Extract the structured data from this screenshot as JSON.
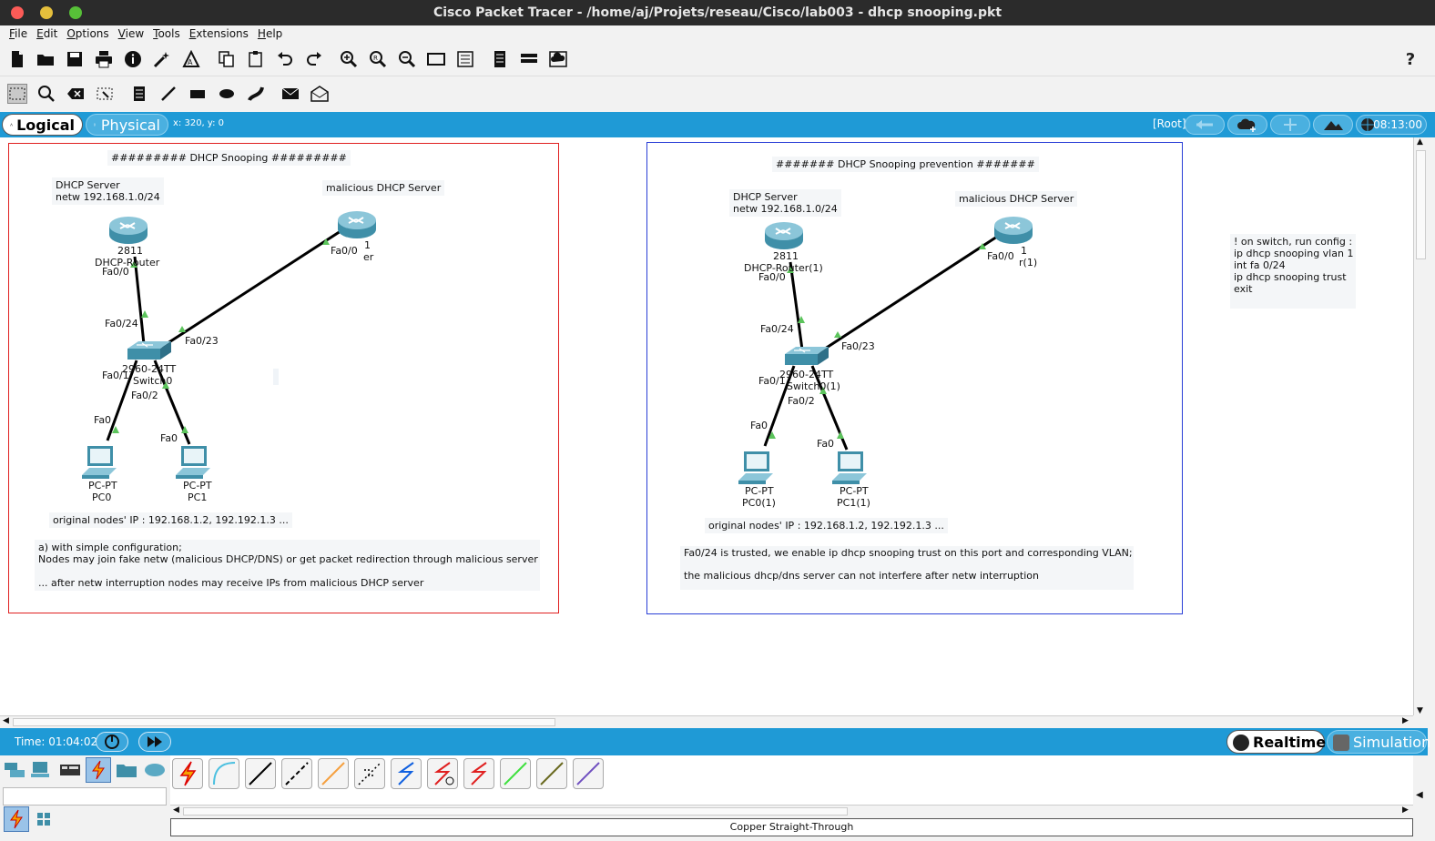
{
  "window": {
    "title": "Cisco Packet Tracer - /home/aj/Projets/reseau/Cisco/lab003 - dhcp snooping.pkt"
  },
  "menu": [
    "File",
    "Edit",
    "Options",
    "View",
    "Tools",
    "Extensions",
    "Help"
  ],
  "toolbar": {
    "main_icons": [
      "new-file-icon",
      "open-folder-icon",
      "save-icon",
      "print-icon",
      "info-icon",
      "activity-wizard-icon",
      "custom-device-icon",
      "copy-icon",
      "paste-icon",
      "undo-icon",
      "redo-icon",
      "zoom-in-icon",
      "zoom-reset-icon",
      "zoom-out-icon",
      "drawing-palette-icon",
      "custom-devices-dialog-icon",
      "pdu-list-icon",
      "network-info-icon",
      "cloud-icon"
    ],
    "help_label": "?"
  },
  "viewbar": {
    "logical_label": "Logical",
    "physical_label": "Physical",
    "coords": "x: 320, y: 0",
    "root_label": "[Root]",
    "clock": "08:13:00"
  },
  "left_topology": {
    "title": "######### DHCP Snooping #########",
    "dhcp_server_note": "DHCP Server\nnetw 192.168.1.0/24",
    "malicious_note": "malicious DHCP Server",
    "router_model": "2811",
    "router_name": "DHCP-Router",
    "malicious_model_tail": "1",
    "malicious_name_tail": "er",
    "switch_model": "2960-24TT",
    "switch_name": "Switch0",
    "pc0_model": "PC-PT",
    "pc0_name": "PC0",
    "pc1_model": "PC-PT",
    "pc1_name": "PC1",
    "ports": {
      "r_fa00": "Fa0/0",
      "m_fa00": "Fa0/0",
      "sw_fa024": "Fa0/24",
      "sw_fa023": "Fa0/23",
      "sw_fa01": "Fa0/1",
      "sw_fa02": "Fa0/2",
      "pc0_fa0": "Fa0",
      "pc1_fa0": "Fa0"
    },
    "ip_note": "original nodes' IP : 192.168.1.2, 192.192.1.3 ...",
    "desc_note": "a) with simple configuration;\nNodes may join fake netw (malicious DHCP/DNS) or get packet redirection through malicious server\n\n... after netw interruption nodes may receive IPs from malicious DHCP server"
  },
  "right_topology": {
    "title": "####### DHCP Snooping prevention #######",
    "dhcp_server_note": "DHCP Server\nnetw 192.168.1.0/24",
    "malicious_note": "malicious DHCP Server",
    "router_model": "2811",
    "router_name": "DHCP-Router(1)",
    "malicious_model_tail": "1",
    "malicious_name_tail": "r(1)",
    "switch_model": "2960-24TT",
    "switch_name": "Switch0(1)",
    "pc0_model": "PC-PT",
    "pc0_name": "PC0(1)",
    "pc1_model": "PC-PT",
    "pc1_name": "PC1(1)",
    "ports": {
      "r_fa00": "Fa0/0",
      "m_fa00": "Fa0/0",
      "sw_fa024": "Fa0/24",
      "sw_fa023": "Fa0/23",
      "sw_fa01": "Fa0/1",
      "sw_fa02": "Fa0/2",
      "pc0_fa0": "Fa0",
      "pc1_fa0": "Fa0"
    },
    "ip_note": "original nodes' IP : 192.168.1.2, 192.192.1.3 ...",
    "desc_note": "Fa0/24 is trusted, we enable ip dhcp snooping trust on this port and corresponding VLAN;\n\nthe malicious dhcp/dns server can not interfere after netw interruption"
  },
  "config_note": "! on switch, run config :\nip dhcp snooping vlan 1\nint fa 0/24\nip dhcp snooping trust\nexit",
  "simbar": {
    "time": "Time: 01:04:02",
    "realtime_label": "Realtime",
    "simulation_label": "Simulation"
  },
  "device_panel": {
    "categories": [
      "network-devices-icon",
      "end-devices-icon",
      "components-icon",
      "connections-icon",
      "miscellaneous-icon",
      "multiuser-icon"
    ],
    "cables": [
      "automatic-cable-icon",
      "console-cable-icon",
      "copper-straight-through-icon",
      "copper-cross-over-icon",
      "fiber-icon",
      "phone-cable-icon",
      "coaxial-cable-icon",
      "serial-dce-icon",
      "serial-dte-icon",
      "octal-cable-icon",
      "iot-custom-cable-icon",
      "usb-cable-icon"
    ],
    "selected_description": "Copper Straight-Through"
  },
  "colors": {
    "accent": "#1f9ad6",
    "left_frame": "#e02020",
    "right_frame": "#2a3fd6",
    "link_up": "#5cc45c"
  }
}
